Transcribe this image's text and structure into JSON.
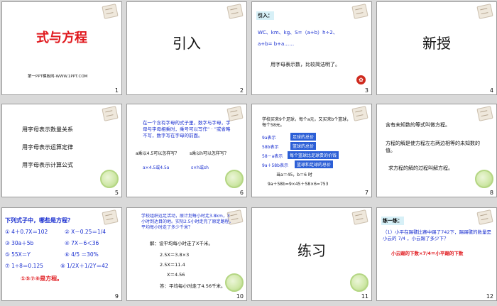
{
  "slides": [
    {
      "n": "1",
      "title": "式与方程",
      "footer": "第一PPT模板网-WWW.1PPT.COM"
    },
    {
      "n": "2",
      "title": "引入"
    },
    {
      "n": "3",
      "heading": "引入：",
      "line1": "WC、km、kg、S=（a+b）h÷2、",
      "line2": "a+b= b+a……",
      "caption": "用字母表示数，比较简洁明了。"
    },
    {
      "n": "4",
      "title": "新授"
    },
    {
      "n": "5",
      "items": [
        "用字母表示数量关系",
        "用字母表示运算定律",
        "用字母表示计算公式"
      ]
    },
    {
      "n": "6",
      "para": "在一个含有字母的式子里，数字与字母，字母与字母相乘时，乘号可以写作“ · ”或省略不写，数字写在字母的前面。",
      "q1": "a乘以4.5可以怎样写？",
      "q2": "s乘以h可以怎样写？",
      "a1": "a×4.5或4.5a",
      "a2": "s×h或sh"
    },
    {
      "n": "7",
      "intro": "学校买来9个足球，每个a元，又买来b个篮球，每个58元。",
      "rows": [
        {
          "expr": "9a表示",
          "meaning": "足球的总价"
        },
        {
          "expr": "58b表示",
          "meaning": "篮球的总价"
        },
        {
          "expr": "58－a表示",
          "meaning": "每个篮球比足球贵的价钱"
        },
        {
          "expr": "9a＋58b表示",
          "meaning": "篮球和足球的总价"
        }
      ],
      "given": "当a＝45，b＝6 时",
      "calc": "9a＋58b=9×45＋58×6=753"
    },
    {
      "n": "8",
      "def1": "含有未知数的等式叫做方程。",
      "def2": "方程的解是使方程左右两边相等的未知数的值。",
      "def3": "求方程的解的过程叫解方程。"
    },
    {
      "n": "9",
      "question": "下列式子中，哪些是方程？",
      "items": [
        "① 4＋0.7X＝102",
        "② X－0.25＝1/4",
        "③ 30a＋5b",
        "④ 7X－6＜36",
        "⑤ 55X＝Y",
        "⑥ 4/5 ＝30%",
        "⑦ 1÷8＝0.125",
        "⑧ 1/2X＋1/2Y＝42"
      ],
      "answer": "①⑤⑦⑧是方程。"
    },
    {
      "n": "10",
      "problem": "学校组织远足活动，原计划每小时走3.8km，3小时到达目的地。实际2.5小时走完了原定路程，平均每小时走了多少千米？",
      "sol": "解：设平均每小时走了X千米。",
      "s1": "2.5X＝3.8×3",
      "s2": "2.5X＝11.4",
      "s3": "X＝4.56",
      "ans": "答：平均每小时走了4.56千米。"
    },
    {
      "n": "11",
      "title": "练习"
    },
    {
      "n": "12",
      "head": "练一练：",
      "prob": "（1）小平在踢毽比赛中踢了742下，踢踢毽的数量是小云的 7/4 ，小云踢了多少下？",
      "eq": "小云踢的下数×7/4＝小平踢的下数"
    }
  ],
  "icons": {
    "seal": "seal-icon",
    "swirl": "swirl-icon",
    "stamp": "stamp-icon"
  }
}
